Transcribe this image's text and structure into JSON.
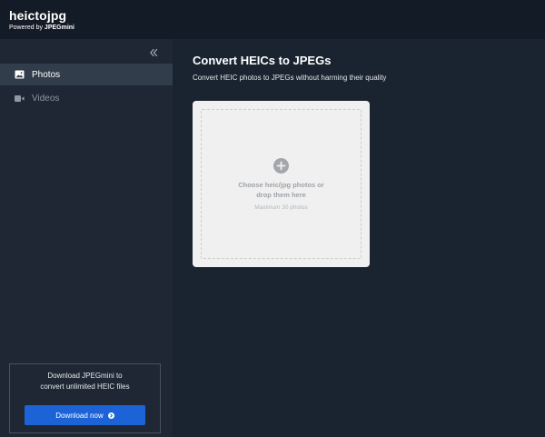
{
  "header": {
    "app_name": "heictojpg",
    "powered_prefix": "Powered by ",
    "powered_brand": "JPEGmini"
  },
  "sidebar": {
    "items": [
      {
        "label": "Photos",
        "icon": "image-icon",
        "active": true
      },
      {
        "label": "Videos",
        "icon": "video-camera-icon",
        "active": false
      }
    ],
    "promo": {
      "line1": "Download JPEGmini to",
      "line2": "convert unlimited HEIC files",
      "button_label": "Download now"
    }
  },
  "main": {
    "title": "Convert HEICs to JPEGs",
    "subtitle": "Convert HEIC photos to JPEGs without harming their quality",
    "dropzone": {
      "line1": "Choose heic/jpg photos or",
      "line2": "drop them here",
      "hint": "Maximum 30 photos"
    }
  },
  "colors": {
    "header_bg": "#131b26",
    "sidebar_bg": "#1e2733",
    "main_bg": "#1a2430",
    "active_item_bg": "#313d4a",
    "accent": "#1d63d8",
    "card_bg": "#f0f0f0"
  }
}
